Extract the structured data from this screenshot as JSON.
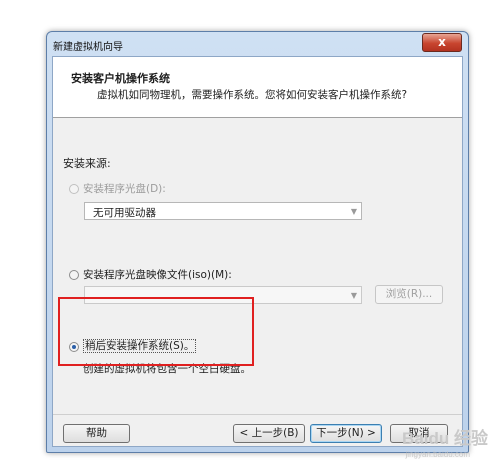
{
  "window": {
    "title": "新建虚拟机向导",
    "close_glyph": "x"
  },
  "header": {
    "title": "安装客户机操作系统",
    "description": "虚拟机如同物理机，需要操作系统。您将如何安装客户机操作系统?"
  },
  "install_source": {
    "label": "安装来源:",
    "options": [
      {
        "label": "安装程序光盘(D):",
        "selected": false,
        "enabled": false
      },
      {
        "label": "安装程序光盘映像文件(iso)(M):",
        "selected": false,
        "enabled": true
      },
      {
        "label": "稍后安装操作系统(S)。",
        "selected": true,
        "enabled": true
      }
    ],
    "disc_combo_value": "无可用驱动器",
    "iso_combo_value": "",
    "browse_label": "浏览(R)...",
    "later_description": "创建的虚拟机将包含一个空白硬盘。"
  },
  "footer": {
    "help": "帮助",
    "back": "< 上一步(B)",
    "next": "下一步(N) >",
    "cancel": "取消"
  },
  "watermark": {
    "brand": "Baidu 经验",
    "url": "jingyan.baidu.com"
  }
}
